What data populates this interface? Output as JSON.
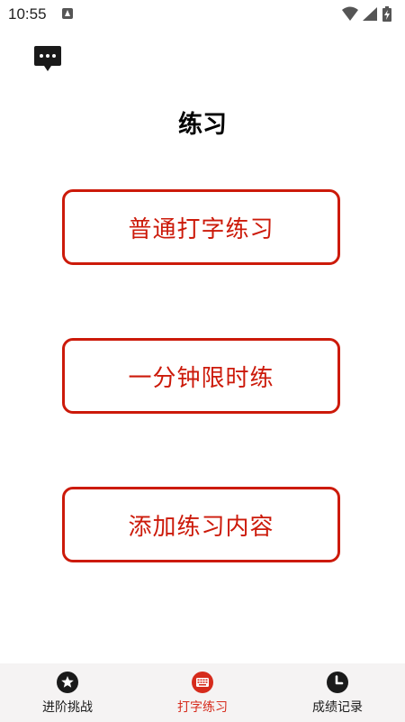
{
  "status_bar": {
    "time": "10:55",
    "icons": [
      "notification-icon",
      "wifi-icon",
      "signal-icon",
      "battery-icon"
    ]
  },
  "header": {
    "chat_icon": "chat-bubble-icon",
    "title": "练习"
  },
  "menu": {
    "items": [
      {
        "label": "普通打字练习"
      },
      {
        "label": "一分钟限时练"
      },
      {
        "label": "添加练习内容"
      }
    ]
  },
  "bottom_nav": {
    "active_index": 1,
    "items": [
      {
        "label": "进阶挑战",
        "icon": "star-icon"
      },
      {
        "label": "打字练习",
        "icon": "keyboard-icon"
      },
      {
        "label": "成绩记录",
        "icon": "clock-icon"
      }
    ]
  },
  "colors": {
    "accent": "#cc1a0a",
    "nav_active": "#d62b1c",
    "nav_background": "#f5f3f3",
    "icon_dark": "#1a1a1a"
  }
}
